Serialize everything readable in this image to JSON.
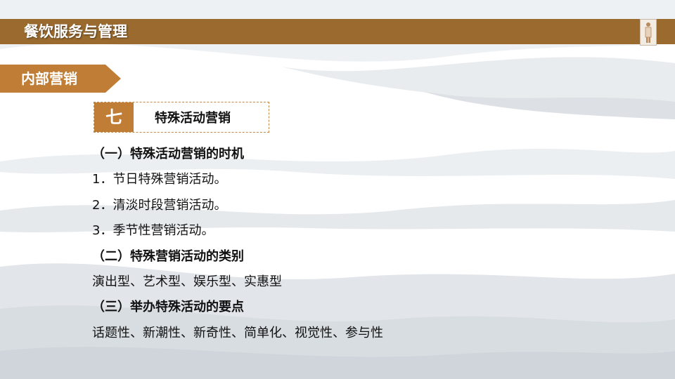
{
  "header": {
    "title": "餐饮服务与管理"
  },
  "section": {
    "label": "内部营销"
  },
  "heading": {
    "number": "七",
    "title": "特殊活动营销"
  },
  "content": {
    "lines": [
      {
        "text": "（一）特殊活动营销的时机",
        "bold": true
      },
      {
        "text": "1．节日特殊营销活动。",
        "bold": false
      },
      {
        "text": "2．清淡时段营销活动。",
        "bold": false
      },
      {
        "text": "3．季节性营销活动。",
        "bold": false
      },
      {
        "text": "（二）特殊营销活动的类别",
        "bold": true
      },
      {
        "text": "演出型、艺术型、娱乐型、实惠型",
        "bold": false
      },
      {
        "text": "（三）举办特殊活动的要点",
        "bold": true
      },
      {
        "text": "话题性、新潮性、新奇性、简单化、视觉性、参与性",
        "bold": false
      }
    ]
  },
  "colors": {
    "title_bar": "#9a6a2e",
    "section_tag": "#c07d35",
    "heading_accent": "#c07d35",
    "wave_gray": "#dfe3e7"
  }
}
